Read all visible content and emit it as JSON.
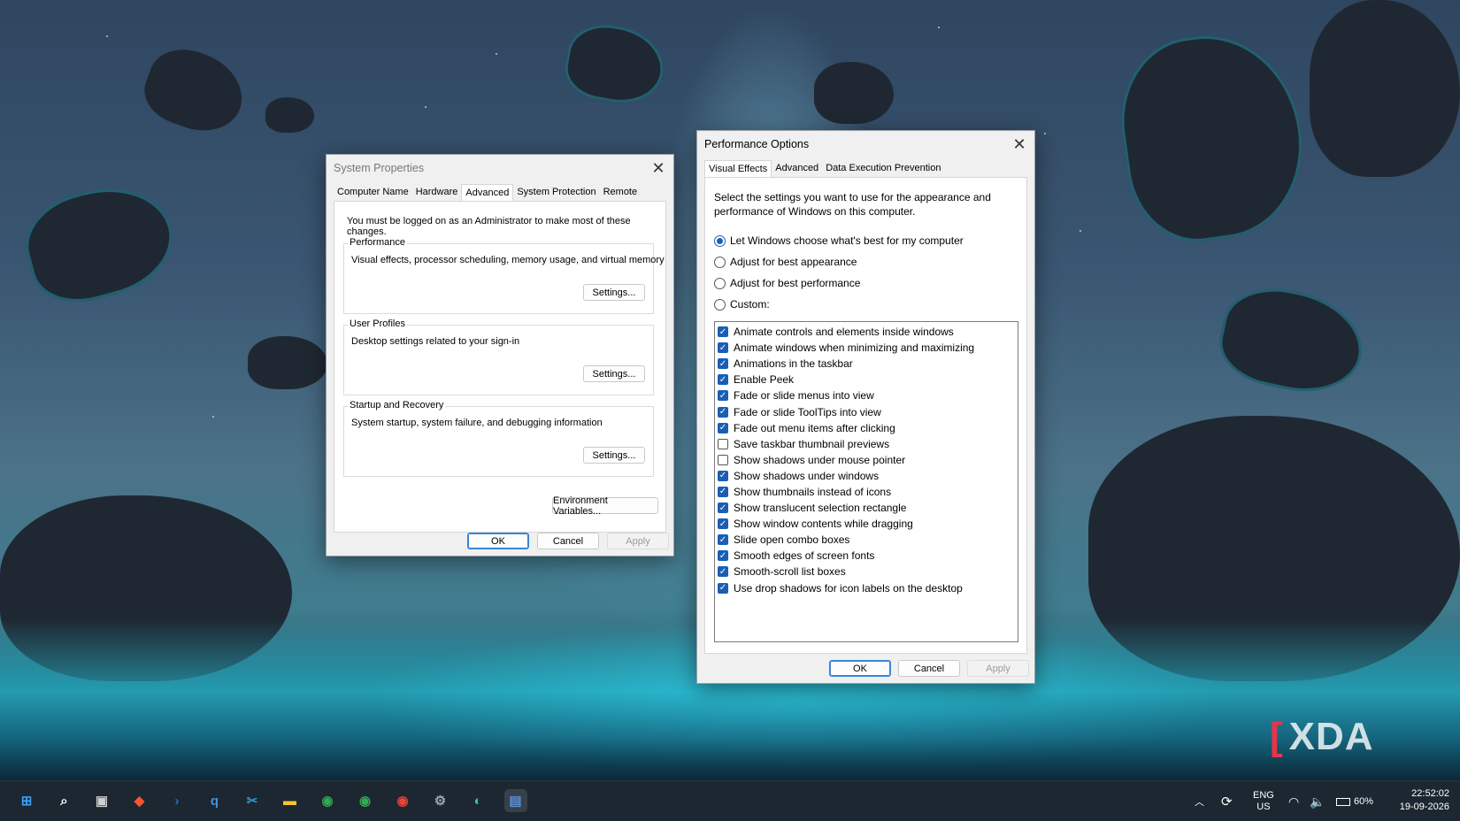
{
  "system_properties": {
    "title": "System Properties",
    "tabs": [
      "Computer Name",
      "Hardware",
      "Advanced",
      "System Protection",
      "Remote"
    ],
    "active_tab": "Advanced",
    "notice": "You must be logged on as an Administrator to make most of these changes.",
    "groups": [
      {
        "legend": "Performance",
        "description": "Visual effects, processor scheduling, memory usage, and virtual memory",
        "button": "Settings..."
      },
      {
        "legend": "User Profiles",
        "description": "Desktop settings related to your sign-in",
        "button": "Settings..."
      },
      {
        "legend": "Startup and Recovery",
        "description": "System startup, system failure, and debugging information",
        "button": "Settings..."
      }
    ],
    "env_button": "Environment Variables...",
    "ok": "OK",
    "cancel": "Cancel",
    "apply": "Apply"
  },
  "performance_options": {
    "title": "Performance Options",
    "tabs": [
      "Visual Effects",
      "Advanced",
      "Data Execution Prevention"
    ],
    "active_tab": "Visual Effects",
    "intro": "Select the settings you want to use for the appearance and performance of Windows on this computer.",
    "radios": [
      {
        "label": "Let Windows choose what's best for my computer",
        "selected": true
      },
      {
        "label": "Adjust for best appearance",
        "selected": false
      },
      {
        "label": "Adjust for best performance",
        "selected": false
      },
      {
        "label": "Custom:",
        "selected": false
      }
    ],
    "effects": [
      {
        "label": "Animate controls and elements inside windows",
        "checked": true
      },
      {
        "label": "Animate windows when minimizing and maximizing",
        "checked": true
      },
      {
        "label": "Animations in the taskbar",
        "checked": true
      },
      {
        "label": "Enable Peek",
        "checked": true
      },
      {
        "label": "Fade or slide menus into view",
        "checked": true
      },
      {
        "label": "Fade or slide ToolTips into view",
        "checked": true
      },
      {
        "label": "Fade out menu items after clicking",
        "checked": true
      },
      {
        "label": "Save taskbar thumbnail previews",
        "checked": false
      },
      {
        "label": "Show shadows under mouse pointer",
        "checked": false
      },
      {
        "label": "Show shadows under windows",
        "checked": true
      },
      {
        "label": "Show thumbnails instead of icons",
        "checked": true
      },
      {
        "label": "Show translucent selection rectangle",
        "checked": true
      },
      {
        "label": "Show window contents while dragging",
        "checked": true
      },
      {
        "label": "Slide open combo boxes",
        "checked": true
      },
      {
        "label": "Smooth edges of screen fonts",
        "checked": true
      },
      {
        "label": "Smooth-scroll list boxes",
        "checked": true
      },
      {
        "label": "Use drop shadows for icon labels on the desktop",
        "checked": true
      }
    ],
    "ok": "OK",
    "cancel": "Cancel",
    "apply": "Apply"
  },
  "watermark": "XDA",
  "taskbar": {
    "apps": [
      {
        "name": "start-icon",
        "color": "#3aa0f5"
      },
      {
        "name": "search-icon",
        "color": "#ffffff"
      },
      {
        "name": "task-view-icon",
        "color": "#d0d0d0"
      },
      {
        "name": "brave-icon",
        "color": "#fb542b"
      },
      {
        "name": "powershell-icon",
        "color": "#2a6fc9"
      },
      {
        "name": "qbittorrent-icon",
        "color": "#4a8fd9"
      },
      {
        "name": "snipping-icon",
        "color": "#1e9ad6"
      },
      {
        "name": "file-explorer-icon",
        "color": "#f4c430"
      },
      {
        "name": "chrome-icon",
        "color": "#34a853"
      },
      {
        "name": "chrome-alt-icon",
        "color": "#34a853"
      },
      {
        "name": "chrome-profile-icon",
        "color": "#ea4335"
      },
      {
        "name": "settings-icon",
        "color": "#9aa4ae"
      },
      {
        "name": "edge-icon",
        "color": "#2cc5a0"
      },
      {
        "name": "system-properties-icon",
        "color": "#5b8fd6"
      }
    ],
    "lang_top": "ENG",
    "lang_bottom": "US",
    "battery": "60%",
    "time": "22:52:02",
    "date": "19-09-2026"
  }
}
